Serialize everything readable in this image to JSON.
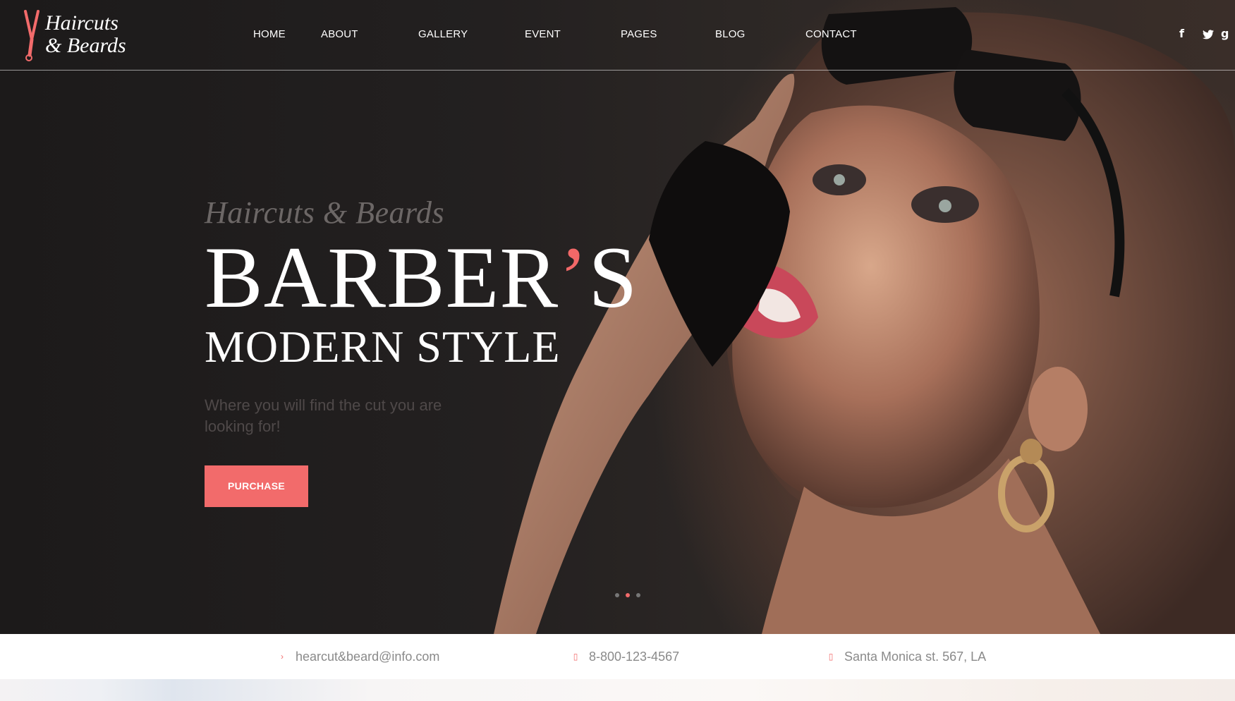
{
  "brand": {
    "line1": "Haircuts",
    "line2": "& Beards",
    "accent_color": "#f26b6b"
  },
  "nav": {
    "items": [
      {
        "label": "HOME"
      },
      {
        "label": "ABOUT"
      },
      {
        "label": "GALLERY"
      },
      {
        "label": "EVENT"
      },
      {
        "label": "PAGES"
      },
      {
        "label": "BLOG"
      },
      {
        "label": "CONTACT"
      }
    ]
  },
  "social": {
    "facebook": "f",
    "twitter": "twitter-icon",
    "google": "g"
  },
  "hero": {
    "script_title": "Haircuts & Beards",
    "title_main": "BARBER",
    "title_apos": "’",
    "title_end": "S",
    "subtitle": "MODERN STYLE",
    "tagline": "Where you will find the cut you are looking for!",
    "button_label": "PURCHASE",
    "slides": 3,
    "active_slide": 2
  },
  "contact": {
    "email": "hearcut&beard@info.com",
    "phone": "8-800-123-4567",
    "address": "Santa Monica st. 567, LA"
  }
}
